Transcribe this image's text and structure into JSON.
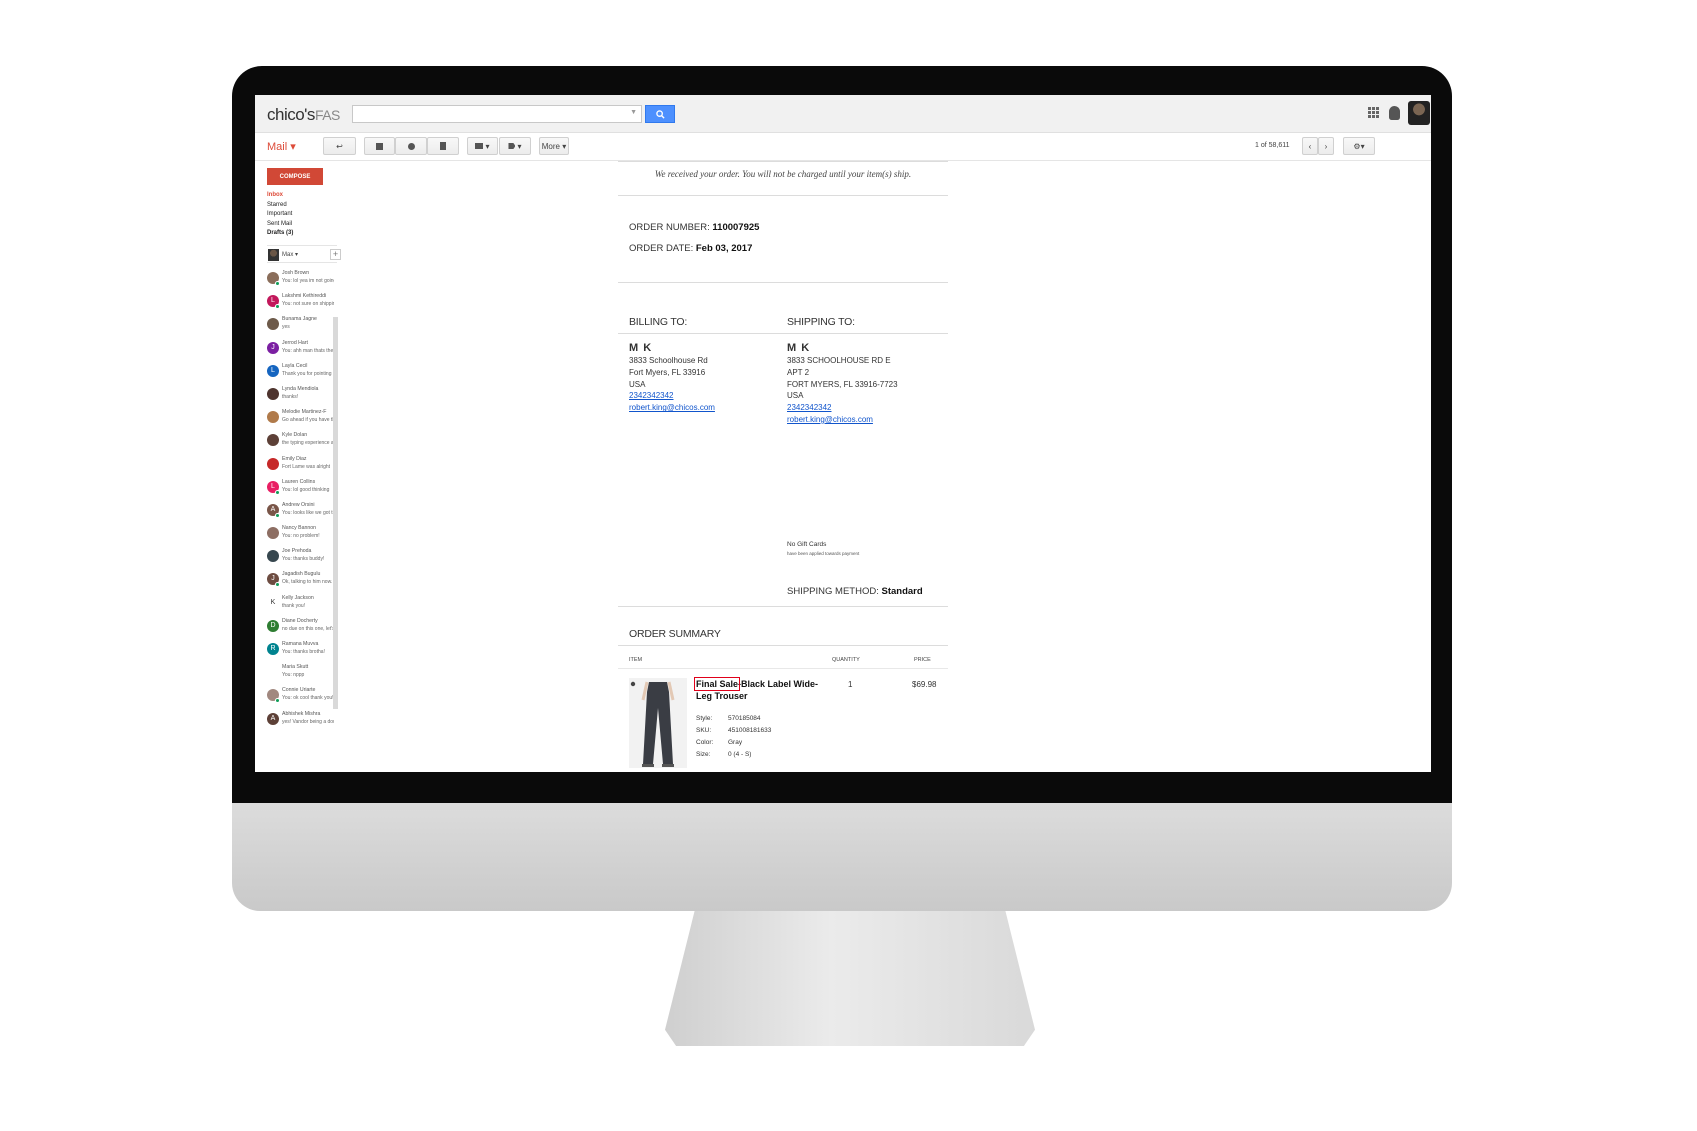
{
  "app": {
    "logo_main": "chico's",
    "logo_sub": "FAS",
    "mail_label": "Mail ▾"
  },
  "toolbar": {
    "more_label": "More ▾",
    "pager": "1 of 58,611"
  },
  "nav": {
    "compose": "COMPOSE",
    "inbox": "Inbox",
    "starred": "Starred",
    "important": "Important",
    "sent": "Sent Mail",
    "drafts": "Drafts (3)",
    "me": "Max ▾"
  },
  "contacts": [
    {
      "name": "Josh Brown",
      "msg": "You: lol yea im not going",
      "initial": "",
      "color": "#8a6d5a",
      "online": true
    },
    {
      "name": "Lakshmi Kethireddi",
      "msg": "You: not sure on shipping",
      "initial": "L",
      "color": "#c2185b",
      "online": true
    },
    {
      "name": "Bunama Jagne",
      "msg": "yes",
      "initial": "",
      "color": "#6d5a4a",
      "online": false
    },
    {
      "name": "Jerrod Hart",
      "msg": "You: ahh man thats the",
      "initial": "J",
      "color": "#7b1fa2",
      "online": false
    },
    {
      "name": "Layla Cecil",
      "msg": "Thank you for pointing it",
      "initial": "L",
      "color": "#1565c0",
      "online": false
    },
    {
      "name": "Lynda Mendiola",
      "msg": "thanks!",
      "initial": "",
      "color": "#4e342e",
      "online": false
    },
    {
      "name": "Melodie Martinez-F",
      "msg": "Go ahead if you have th",
      "initial": "",
      "color": "#b07a4a",
      "online": false
    },
    {
      "name": "Kyle Dolan",
      "msg": "the typing experience al",
      "initial": "",
      "color": "#5d4037",
      "online": false
    },
    {
      "name": "Emily Diaz",
      "msg": "Fort Lame was alright",
      "initial": "",
      "color": "#c62828",
      "online": false
    },
    {
      "name": "Lauren Collins",
      "msg": "You: lol good thinking",
      "initial": "L",
      "color": "#e91e63",
      "online": true
    },
    {
      "name": "Andrew Orsini",
      "msg": "You: looks like we got th",
      "initial": "A",
      "color": "#795548",
      "online": true
    },
    {
      "name": "Nancy Bannon",
      "msg": "You: no problem!",
      "initial": "",
      "color": "#8d6e63",
      "online": false
    },
    {
      "name": "Joe Prehoda",
      "msg": "You: thanks buddy!",
      "initial": "",
      "color": "#37474f",
      "online": false
    },
    {
      "name": "Jagadish Bugulu",
      "msg": "Ok, talking to him now.",
      "initial": "J",
      "color": "#6d4c41",
      "online": true
    },
    {
      "name": "Kelly Jackson",
      "msg": "thank you!",
      "initial": "K",
      "color": "#ffffff",
      "online": false
    },
    {
      "name": "Diane Docherty",
      "msg": "no due on this one, let's",
      "initial": "D",
      "color": "#2e7d32",
      "online": false
    },
    {
      "name": "Ramana Muvva",
      "msg": "You: thanks brotha!",
      "initial": "R",
      "color": "#00838f",
      "online": false
    },
    {
      "name": "Maria Skutt",
      "msg": "You: nppp",
      "initial": "",
      "color": "#ffffff",
      "online": false
    },
    {
      "name": "Connie Uriarte",
      "msg": "You: ok cool thank you!",
      "initial": "",
      "color": "#a1887f",
      "online": true
    },
    {
      "name": "Abhishek Mishra",
      "msg": "yes! Vandor being a dou",
      "initial": "A",
      "color": "#5d4037",
      "online": false
    }
  ],
  "email": {
    "received_note": "We received your order. You will not be charged until your item(s) ship.",
    "order_number_label": "ORDER NUMBER:",
    "order_number": "110007925",
    "order_date_label": "ORDER DATE:",
    "order_date": "Feb 03, 2017",
    "billing": {
      "title": "BILLING TO:",
      "name": "M K",
      "line1": "3833 Schoolhouse Rd",
      "line2": "Fort Myers, FL 33916",
      "line3": "USA",
      "phone": "2342342342",
      "email": "robert.king@chicos.com"
    },
    "shipping": {
      "title": "SHIPPING TO:",
      "name": "M K",
      "line1": "3833 SCHOOLHOUSE RD E",
      "line2": "APT 2",
      "line3": "FORT MYERS, FL 33916-7723",
      "line4": "USA",
      "phone": "2342342342",
      "email": "robert.king@chicos.com"
    },
    "gift_cards": "No Gift Cards",
    "gift_cards_note": "have been applied towards payment",
    "shipping_method_label": "SHIPPING METHOD:",
    "shipping_method": "Standard",
    "summary_title": "ORDER SUMMARY",
    "col_item": "ITEM",
    "col_quantity": "QUANTITY",
    "col_price": "PRICE",
    "item": {
      "final_sale": "Final Sale",
      "name_rest": "-Black Label Wide-Leg Trouser",
      "quantity": "1",
      "price": "$69.98",
      "style_label": "Style:",
      "style": "570185084",
      "sku_label": "SKU:",
      "sku": "451008181633",
      "color_label": "Color:",
      "color": "Gray",
      "size_label": "Size:",
      "size": "0 (4 - S)"
    }
  },
  "colors": {
    "compose_red": "#d14836",
    "search_blue": "#4d90fe",
    "link_blue": "#1155cc",
    "highlight_red": "#e0001a"
  }
}
